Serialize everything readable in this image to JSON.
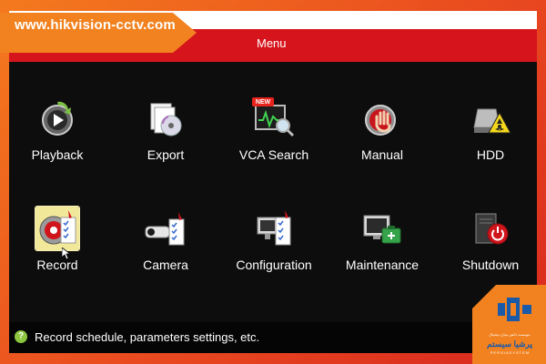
{
  "watermark": {
    "site": "www.hikvision-cctv.com"
  },
  "header": {
    "title": "Menu"
  },
  "menu": {
    "items": [
      {
        "label": "Playback",
        "icon": "playback-icon"
      },
      {
        "label": "Export",
        "icon": "export-icon"
      },
      {
        "label": "VCA Search",
        "icon": "vca-search-icon",
        "badge": "NEW"
      },
      {
        "label": "Manual",
        "icon": "manual-icon"
      },
      {
        "label": "HDD",
        "icon": "hdd-icon"
      },
      {
        "label": "Record",
        "icon": "record-icon",
        "selected": true
      },
      {
        "label": "Camera",
        "icon": "camera-icon"
      },
      {
        "label": "Configuration",
        "icon": "configuration-icon"
      },
      {
        "label": "Maintenance",
        "icon": "maintenance-icon"
      },
      {
        "label": "Shutdown",
        "icon": "shutdown-icon"
      }
    ]
  },
  "status": {
    "icon": "help-icon",
    "glyph": "?",
    "text": "Record schedule, parameters settings, etc."
  },
  "logo": {
    "line1": "موسسه دانش بنیان دیجیتال",
    "line2": "پرشیا سیستم",
    "line3": "P E R S I A   S Y S T E M"
  },
  "colors": {
    "header_red": "#d6141c",
    "watermark_orange": "#f2821f",
    "status_green": "#8cc63f",
    "selection_yellow": "#f2e89a"
  }
}
